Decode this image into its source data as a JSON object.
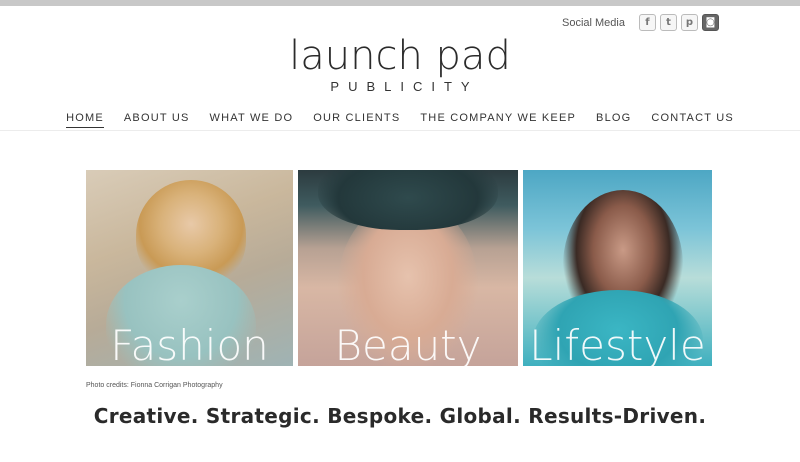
{
  "social": {
    "label": "Social Media",
    "icons": [
      {
        "name": "facebook-icon",
        "glyph": "f"
      },
      {
        "name": "twitter-icon",
        "glyph": "t"
      },
      {
        "name": "pinterest-icon",
        "glyph": "p"
      },
      {
        "name": "instagram-icon",
        "glyph": "◙"
      }
    ]
  },
  "logo": {
    "main": "launch pad",
    "sub": "PUBLICITY"
  },
  "nav": {
    "items": [
      {
        "label": "HOME",
        "active": true
      },
      {
        "label": "ABOUT US"
      },
      {
        "label": "WHAT WE DO"
      },
      {
        "label": "OUR CLIENTS"
      },
      {
        "label": "THE COMPANY WE KEEP"
      },
      {
        "label": "BLOG"
      },
      {
        "label": "CONTACT US"
      }
    ]
  },
  "panels": [
    {
      "label": "Fashion"
    },
    {
      "label": "Beauty"
    },
    {
      "label": "Lifestyle"
    }
  ],
  "credits": "Photo credits: Fionna Corrigan Photography",
  "tagline": "Creative. Strategic. Bespoke. Global. Results-Driven.",
  "colors": {
    "text": "#333333",
    "background": "#ffffff",
    "top_bar": "#c8c8c8"
  }
}
